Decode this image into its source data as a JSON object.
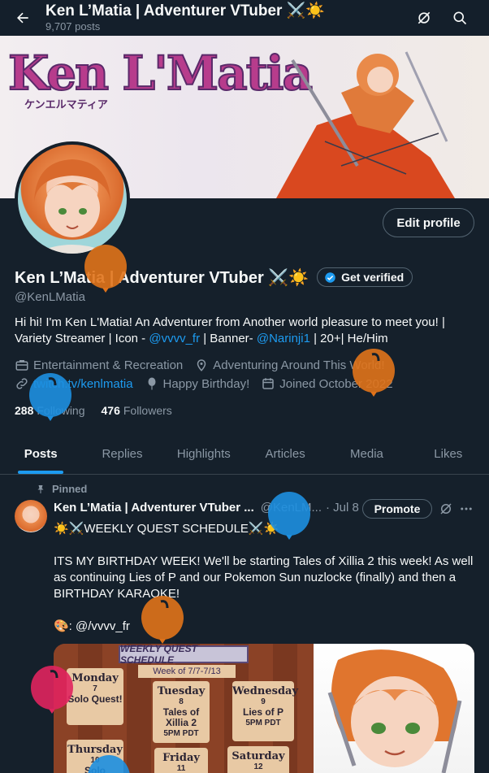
{
  "header": {
    "title": "Ken L’Matia | Adventurer VTuber ⚔️☀️",
    "posts_count": "9,707 posts"
  },
  "banner": {
    "logo_text": "Ken L'Matia",
    "logo_sub": "ケンエルマティア"
  },
  "profile": {
    "edit_label": "Edit profile",
    "display_name": "Ken L’Matia | Adventurer VTuber ⚔️☀️",
    "get_verified": "Get verified",
    "handle": "@KenLMatia",
    "bio_1": "Hi hi! I'm Ken L'Matia! An Adventurer from Another world pleasure to meet you! | Variety Streamer | Icon - ",
    "bio_link_1": "@vvvv_fr",
    "bio_2": " | Banner- ",
    "bio_link_2": "@Narinji1",
    "bio_3": " | 20+| He/Him",
    "category": "Entertainment & Recreation",
    "location": "Adventuring Around This World!",
    "website": "twitch.tv/kenlmatia",
    "birthday": "Happy Birthday!",
    "joined": "Joined October 2022",
    "following_count": "288",
    "following_label": "Following",
    "followers_count": "476",
    "followers_label": "Followers"
  },
  "tabs": [
    "Posts",
    "Replies",
    "Highlights",
    "Articles",
    "Media",
    "Likes"
  ],
  "post": {
    "pinned_label": "Pinned",
    "author": "Ken L’Matia | Adventurer VTuber ...",
    "handle": "@KenLM...",
    "date": "· Jul 8",
    "promote_label": "Promote",
    "line_1": "☀️⚔️WEEKLY QUEST SCHEDULE⚔️☀️",
    "line_2": "ITS MY BIRTHDAY WEEK! We'll be starting Tales of Xillia 2 this week! As well as continuing Lies of P and our Pokemon Sun nuzlocke (finally) and then a BIRTHDAY KARAOKE!",
    "line_3": "🎨: @/vvvv_fr"
  },
  "schedule": {
    "title": "WEEKLY QUEST SCHEDULE",
    "week": "Week of 7/7-7/13",
    "days": [
      {
        "day": "Monday",
        "num": "7",
        "event": "Solo Quest!",
        "time": ""
      },
      {
        "day": "Tuesday",
        "num": "8",
        "event": "Tales of Xillia 2",
        "time": "5PM PDT"
      },
      {
        "day": "Wednesday",
        "num": "9",
        "event": "Lies of P",
        "time": "5PM PDT"
      },
      {
        "day": "Thursday",
        "num": "10",
        "event": "Solo",
        "time": ""
      },
      {
        "day": "Friday",
        "num": "11",
        "event": "",
        "time": ""
      },
      {
        "day": "Saturday",
        "num": "12",
        "event": "",
        "time": ""
      }
    ]
  },
  "colors": {
    "background": "#15202b",
    "accent": "#1d9bf0",
    "muted": "#8b98a5",
    "balloon_orange": "#e0731a",
    "balloon_blue": "#1d8fe0",
    "balloon_pink": "#e0245e"
  }
}
